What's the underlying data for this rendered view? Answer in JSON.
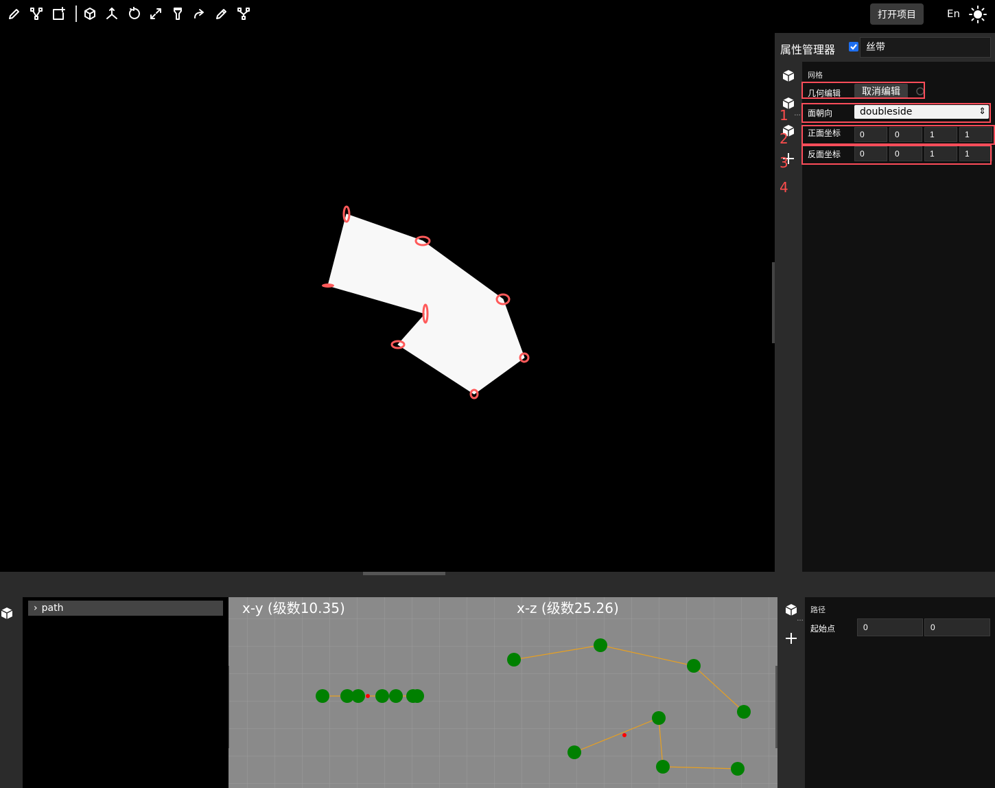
{
  "toolbar": {
    "tools": [
      "pencil-icon",
      "vertex-edit-icon",
      "add-shape-icon",
      "cube-icon",
      "axes-icon",
      "rotate-icon",
      "scale-icon",
      "flashlight-icon",
      "redo-icon",
      "pen-icon",
      "branch-icon"
    ],
    "open_project_label": "打开项目",
    "lang_label": "En",
    "theme_icon": "sun-icon"
  },
  "property_panel": {
    "title": "属性管理器",
    "enabled": true,
    "object_name": "丝带",
    "section_label": "网格",
    "annotation_numbers": [
      "1",
      "2",
      "3",
      "4"
    ],
    "rail_icons": [
      "cube-icon",
      "cube-icon",
      "cube-icon",
      "plus-icon"
    ],
    "geometry_edit": {
      "label": "几何编辑",
      "button_label": "取消编辑"
    },
    "face_direction": {
      "label": "面朝向",
      "value": "doubleside"
    },
    "front_coords": {
      "label": "正面坐标",
      "values": [
        "0",
        "0",
        "1",
        "1"
      ]
    },
    "back_coords": {
      "label": "反面坐标",
      "values": [
        "0",
        "0",
        "1",
        "1"
      ]
    }
  },
  "tree": {
    "items": [
      {
        "label": "path",
        "expanded": false
      }
    ]
  },
  "path_views": {
    "xy": {
      "title": "x-y (级数10.35)"
    },
    "xz": {
      "title": "x-z (级数25.26)"
    }
  },
  "bottom_property": {
    "section_label": "路径",
    "start_point": {
      "label": "起始点",
      "values": [
        "0",
        "0"
      ]
    }
  },
  "colors": {
    "accent_checkbox": "#1e6ff0",
    "annotation_red": "#ff4d5a",
    "path_point_green": "#008000",
    "path_line_orange": "#e8a020",
    "mesh_fill": "#f8f8f8"
  }
}
